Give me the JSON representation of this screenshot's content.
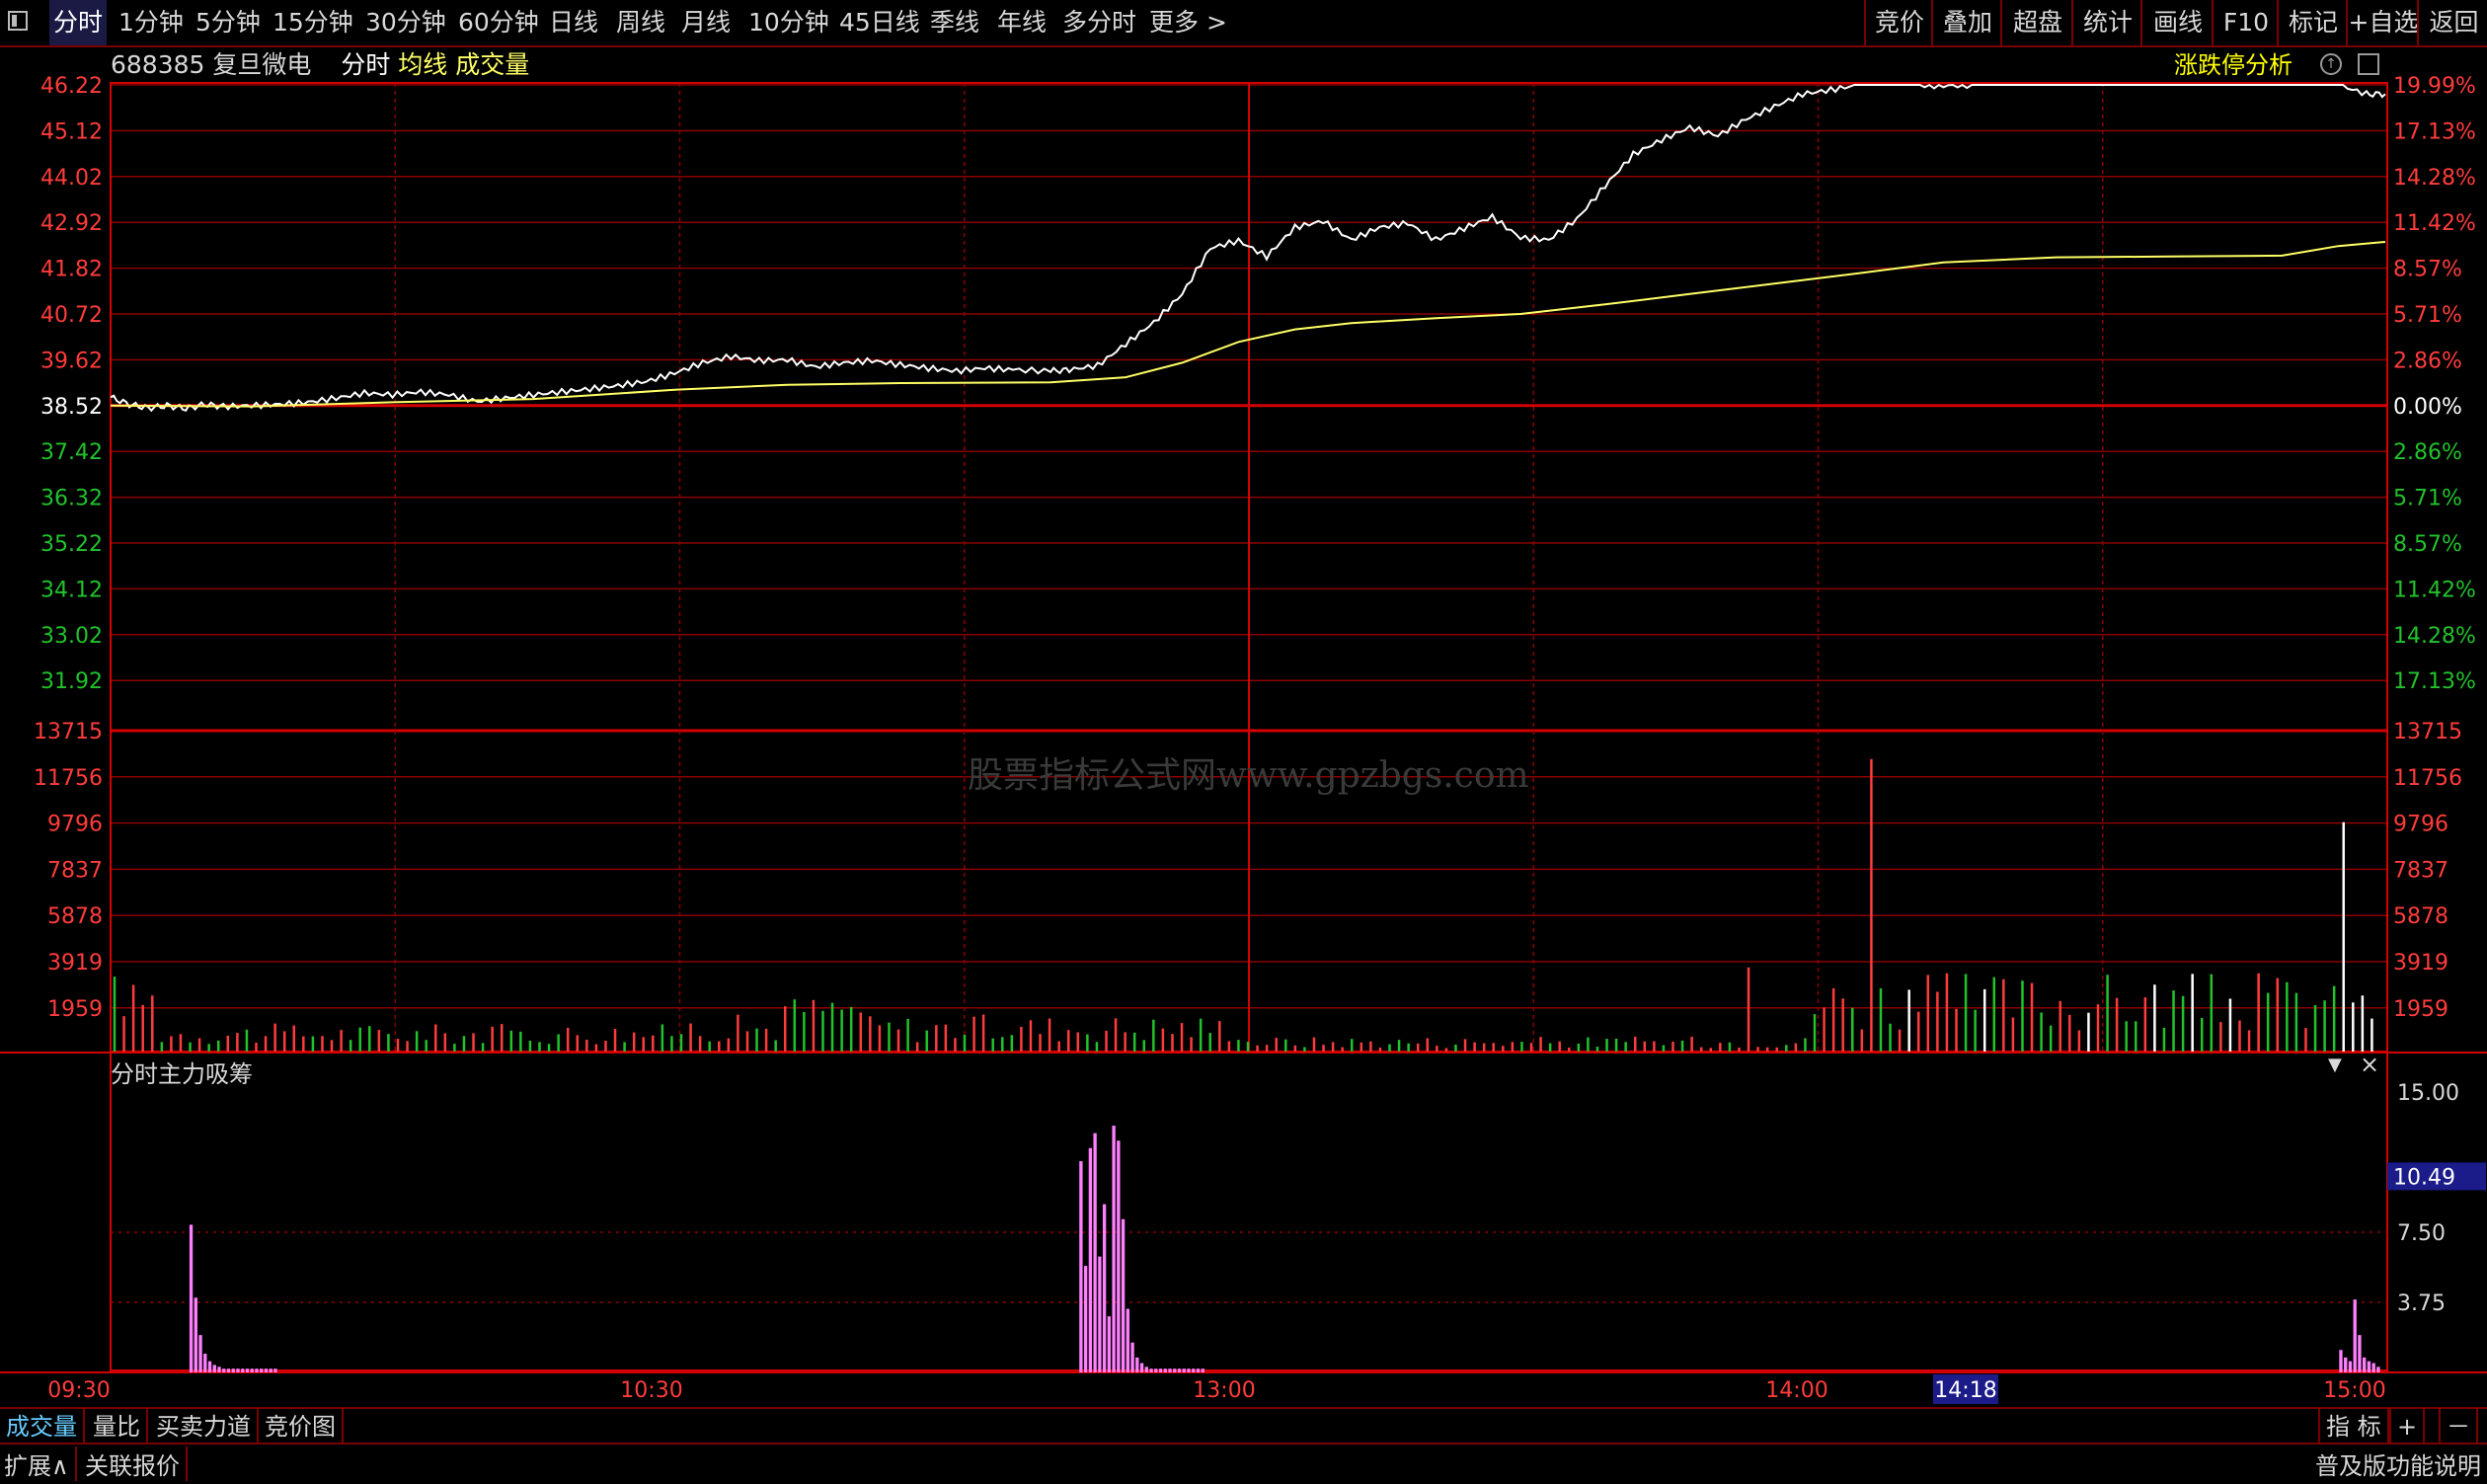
{
  "toolbar": {
    "periods": [
      "分时",
      "1分钟",
      "5分钟",
      "15分钟",
      "30分钟",
      "60分钟",
      "日线",
      "周线",
      "月线",
      "10分钟",
      "45日线",
      "季线",
      "年线",
      "多分时",
      "更多 >"
    ],
    "right": [
      "竞价",
      "叠加",
      "超盘",
      "统计",
      "画线",
      "F10",
      "标记",
      "+自选",
      "返回"
    ]
  },
  "header": {
    "code": "688385",
    "name": "复旦微电",
    "mode": "分时",
    "avg_label": "均线",
    "vol_label": "成交量",
    "zdt_label": "涨跌停分析"
  },
  "watermark": "股票指标公式网www.gpzbgs.com",
  "colors": {
    "up": "#ff3c3c",
    "down": "#22c22c",
    "price_line": "#ffffff",
    "avg_line": "#ffff66",
    "grid": "#8c0000",
    "indicator": "#ff80ff",
    "axis_text_red": "#ff3c3c",
    "axis_text_green": "#22c22c"
  },
  "chart_data": [
    {
      "type": "line",
      "name": "price",
      "prev_close": 38.52,
      "price_axis_left": [
        "46.22",
        "45.12",
        "44.02",
        "42.92",
        "41.82",
        "40.72",
        "39.62",
        "38.52",
        "37.42",
        "36.32",
        "35.22",
        "34.12",
        "33.02",
        "31.92"
      ],
      "pct_axis_right": [
        "19.99%",
        "17.13%",
        "14.28%",
        "11.42%",
        "8.57%",
        "5.71%",
        "2.86%",
        "0.00%",
        "2.86%",
        "5.71%",
        "8.57%",
        "11.42%",
        "14.28%",
        "17.13%"
      ],
      "ylim": [
        31.92,
        46.22
      ],
      "x_minutes": 240,
      "price_points": [
        [
          0,
          38.72
        ],
        [
          4,
          38.55
        ],
        [
          8,
          38.46
        ],
        [
          12,
          38.52
        ],
        [
          16,
          38.45
        ],
        [
          20,
          38.55
        ],
        [
          24,
          38.5
        ],
        [
          30,
          38.52
        ],
        [
          36,
          38.55
        ],
        [
          42,
          38.6
        ],
        [
          48,
          38.7
        ],
        [
          54,
          38.82
        ],
        [
          60,
          38.78
        ],
        [
          66,
          38.85
        ],
        [
          72,
          38.78
        ],
        [
          78,
          38.62
        ],
        [
          84,
          38.7
        ],
        [
          90,
          38.78
        ],
        [
          96,
          38.85
        ],
        [
          102,
          38.92
        ],
        [
          108,
          39.0
        ],
        [
          114,
          39.1
        ],
        [
          120,
          39.3
        ],
        [
          126,
          39.55
        ],
        [
          132,
          39.7
        ],
        [
          138,
          39.6
        ],
        [
          144,
          39.62
        ],
        [
          150,
          39.45
        ],
        [
          156,
          39.55
        ],
        [
          162,
          39.6
        ],
        [
          168,
          39.5
        ],
        [
          174,
          39.42
        ],
        [
          180,
          39.35
        ],
        [
          186,
          39.42
        ],
        [
          192,
          39.38
        ],
        [
          200,
          39.35
        ],
        [
          204,
          39.38
        ],
        [
          210,
          39.48
        ],
        [
          216,
          40.0
        ],
        [
          222,
          40.52
        ],
        [
          228,
          41.2
        ],
        [
          234,
          42.3
        ],
        [
          240,
          42.48
        ],
        [
          246,
          42.1
        ],
        [
          252,
          42.8
        ],
        [
          258,
          42.95
        ],
        [
          264,
          42.5
        ],
        [
          270,
          42.8
        ],
        [
          276,
          42.9
        ],
        [
          282,
          42.5
        ],
        [
          288,
          42.78
        ],
        [
          294,
          43.05
        ],
        [
          300,
          42.55
        ],
        [
          306,
          42.5
        ],
        [
          312,
          43.0
        ],
        [
          318,
          43.8
        ],
        [
          324,
          44.55
        ],
        [
          330,
          44.9
        ],
        [
          336,
          45.2
        ],
        [
          342,
          45.0
        ],
        [
          348,
          45.4
        ],
        [
          354,
          45.7
        ],
        [
          360,
          46.0
        ],
        [
          366,
          46.1
        ],
        [
          372,
          46.22
        ],
        [
          378,
          46.22
        ],
        [
          384,
          46.22
        ],
        [
          390,
          46.2
        ],
        [
          396,
          46.22
        ],
        [
          402,
          46.22
        ],
        [
          408,
          46.22
        ],
        [
          414,
          46.22
        ],
        [
          420,
          46.22
        ],
        [
          426,
          46.22
        ],
        [
          432,
          46.22
        ],
        [
          438,
          46.22
        ],
        [
          444,
          46.22
        ],
        [
          450,
          46.22
        ],
        [
          456,
          46.22
        ],
        [
          462,
          46.22
        ],
        [
          468,
          46.22
        ],
        [
          474,
          46.22
        ],
        [
          480,
          46.0
        ],
        [
          484,
          46.0
        ]
      ],
      "avg_points": [
        [
          0,
          38.52
        ],
        [
          30,
          38.5
        ],
        [
          60,
          38.6
        ],
        [
          90,
          38.68
        ],
        [
          120,
          38.9
        ],
        [
          144,
          39.02
        ],
        [
          168,
          39.06
        ],
        [
          200,
          39.08
        ],
        [
          216,
          39.2
        ],
        [
          228,
          39.55
        ],
        [
          240,
          40.05
        ],
        [
          252,
          40.35
        ],
        [
          264,
          40.5
        ],
        [
          282,
          40.62
        ],
        [
          300,
          40.72
        ],
        [
          318,
          40.95
        ],
        [
          336,
          41.2
        ],
        [
          354,
          41.45
        ],
        [
          372,
          41.7
        ],
        [
          390,
          41.96
        ],
        [
          414,
          42.08
        ],
        [
          438,
          42.1
        ],
        [
          462,
          42.12
        ],
        [
          474,
          42.35
        ],
        [
          484,
          42.45
        ]
      ]
    },
    {
      "type": "bar",
      "name": "volume",
      "vol_axis_left": [
        "13715",
        "11756",
        "9796",
        "7837",
        "5878",
        "3919",
        "1959"
      ],
      "vol_axis_right": [
        "13715",
        "11756",
        "9796",
        "7837",
        "5878",
        "3919",
        "1959"
      ],
      "ylim": [
        0,
        13715
      ],
      "x_ticks": [
        "09:30",
        "10:30",
        "13:00",
        "14:00",
        "14:18",
        "15:00"
      ],
      "volume_seed": 17
    },
    {
      "type": "bar",
      "name": "分时主力吸筹",
      "axis_right": [
        "15.00",
        "7.50",
        "3.75"
      ],
      "current_value": "10.49",
      "ylim": [
        0,
        15.0
      ],
      "series": [
        {
          "start": 16,
          "values": [
            7.9,
            4.0,
            2.0,
            1.0,
            0.6,
            0.4,
            0.3,
            0.2,
            0.2,
            0.2,
            0.2,
            0.2,
            0.2,
            0.2,
            0.2,
            0.2,
            0.2,
            0.2,
            0.2
          ]
        },
        {
          "start": 206,
          "values": [
            11.3,
            5.7,
            12.0,
            12.8,
            6.2,
            9.0,
            3.0,
            13.2,
            12.4,
            8.2,
            3.4,
            1.6,
            0.8,
            0.5,
            0.3,
            0.2,
            0.2,
            0.2,
            0.2,
            0.2,
            0.2,
            0.2,
            0.2,
            0.2,
            0.2,
            0.2,
            0.2
          ]
        },
        {
          "start": 475,
          "values": [
            1.2,
            0.8,
            0.6,
            3.9,
            2.0,
            0.8,
            0.6,
            0.5,
            0.3
          ]
        }
      ]
    }
  ],
  "bottom_tabs": [
    "成交量",
    "量比",
    "买卖力道",
    "竞价图"
  ],
  "bottom_right": [
    "指 标",
    "+",
    "－"
  ],
  "footer": {
    "left": [
      "扩展∧",
      "关联报价"
    ],
    "right": "普及版功能说明"
  }
}
